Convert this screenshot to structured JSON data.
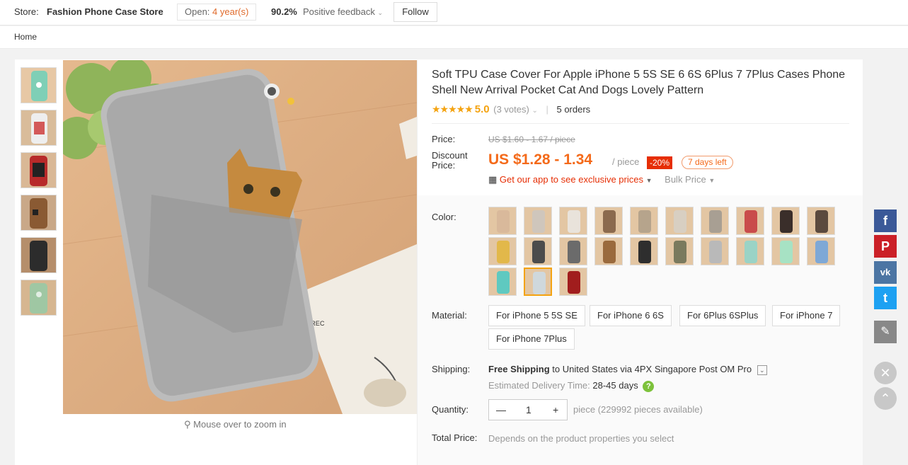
{
  "topbar": {
    "store_label": "Store:",
    "store_name": "Fashion Phone Case Store",
    "open_label": "Open:",
    "open_years": "4 year(s)",
    "feedback_pct": "90.2%",
    "feedback_label": "Positive feedback",
    "follow_label": "Follow"
  },
  "breadcrumb": {
    "home": "Home"
  },
  "gallery": {
    "zoom_hint": "Mouse over to zoom in",
    "thumb_colors": [
      "#7fcfb6",
      "#eeeeee",
      "#b72a2a",
      "#8a5a33",
      "#2c2c2c",
      "#9fc7a3"
    ]
  },
  "product": {
    "title": "Soft TPU Case Cover For Apple iPhone 5 5S SE 6 6S 6Plus 7 7Plus Cases Phone Shell New Arrival Pocket Cat And Dogs Lovely Pattern",
    "stars": "★★★★★",
    "score": "5.0",
    "votes": "(3 votes)",
    "orders": "5 orders"
  },
  "price": {
    "price_label": "Price:",
    "old_price": "US $1.60 - 1.67 / piece",
    "discount_label_1": "Discount",
    "discount_label_2": "Price:",
    "new_price": "US $1.28 - 1.34",
    "per": "/ piece",
    "discount_badge": "-20%",
    "days_left": "7 days left",
    "app_text": "Get our app to see exclusive prices",
    "bulk_price": "Bulk Price"
  },
  "color": {
    "label": "Color:",
    "swatches": [
      "#d9b99b",
      "#cfc6bc",
      "#e9e3db",
      "#8b6a4e",
      "#b6a48c",
      "#d8cfc2",
      "#a89f93",
      "#c94b4b",
      "#3a2e2a",
      "#5b4a3e",
      "#e2b84a",
      "#4c4c4c",
      "#6b6b6b",
      "#9a6a3d",
      "#2e2e2e",
      "#7a7a5e",
      "#b9b9b9",
      "#9ad3c6",
      "#a7e2c4",
      "#7ea8d6",
      "#5fc9c0",
      "#cfd8dc",
      "#a11d1d"
    ],
    "selected_index": 21
  },
  "material": {
    "label": "Material:",
    "options": [
      "For iPhone 5 5S SE",
      "For iPhone 6 6S",
      "For 6Plus 6SPlus",
      "For iPhone 7",
      "For iPhone 7Plus"
    ]
  },
  "shipping": {
    "label": "Shipping:",
    "free": "Free Shipping",
    "to_text": "to United States via 4PX Singapore Post OM Pro",
    "eta_label": "Estimated Delivery Time:",
    "eta_days": "28-45 days"
  },
  "quantity": {
    "label": "Quantity:",
    "value": "1",
    "available": "piece (229992 pieces available)"
  },
  "total": {
    "label": "Total Price:",
    "text": "Depends on the product properties you select"
  },
  "social": {
    "facebook": "f",
    "pinterest": "P",
    "vk": "vk",
    "twitter": "t"
  }
}
